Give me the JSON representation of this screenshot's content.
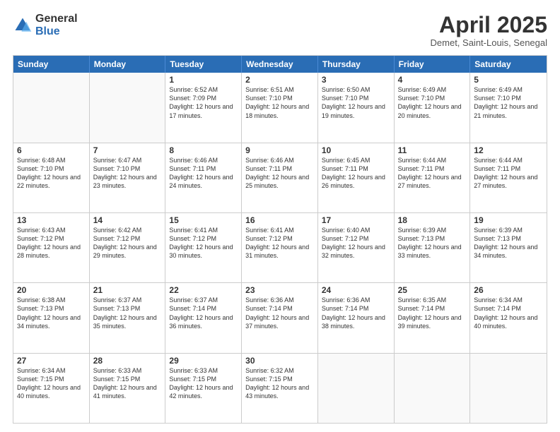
{
  "logo": {
    "general": "General",
    "blue": "Blue"
  },
  "title": "April 2025",
  "subtitle": "Demet, Saint-Louis, Senegal",
  "days": [
    "Sunday",
    "Monday",
    "Tuesday",
    "Wednesday",
    "Thursday",
    "Friday",
    "Saturday"
  ],
  "rows": [
    [
      {
        "day": "",
        "info": ""
      },
      {
        "day": "",
        "info": ""
      },
      {
        "day": "1",
        "info": "Sunrise: 6:52 AM\nSunset: 7:09 PM\nDaylight: 12 hours and 17 minutes."
      },
      {
        "day": "2",
        "info": "Sunrise: 6:51 AM\nSunset: 7:10 PM\nDaylight: 12 hours and 18 minutes."
      },
      {
        "day": "3",
        "info": "Sunrise: 6:50 AM\nSunset: 7:10 PM\nDaylight: 12 hours and 19 minutes."
      },
      {
        "day": "4",
        "info": "Sunrise: 6:49 AM\nSunset: 7:10 PM\nDaylight: 12 hours and 20 minutes."
      },
      {
        "day": "5",
        "info": "Sunrise: 6:49 AM\nSunset: 7:10 PM\nDaylight: 12 hours and 21 minutes."
      }
    ],
    [
      {
        "day": "6",
        "info": "Sunrise: 6:48 AM\nSunset: 7:10 PM\nDaylight: 12 hours and 22 minutes."
      },
      {
        "day": "7",
        "info": "Sunrise: 6:47 AM\nSunset: 7:10 PM\nDaylight: 12 hours and 23 minutes."
      },
      {
        "day": "8",
        "info": "Sunrise: 6:46 AM\nSunset: 7:11 PM\nDaylight: 12 hours and 24 minutes."
      },
      {
        "day": "9",
        "info": "Sunrise: 6:46 AM\nSunset: 7:11 PM\nDaylight: 12 hours and 25 minutes."
      },
      {
        "day": "10",
        "info": "Sunrise: 6:45 AM\nSunset: 7:11 PM\nDaylight: 12 hours and 26 minutes."
      },
      {
        "day": "11",
        "info": "Sunrise: 6:44 AM\nSunset: 7:11 PM\nDaylight: 12 hours and 27 minutes."
      },
      {
        "day": "12",
        "info": "Sunrise: 6:44 AM\nSunset: 7:11 PM\nDaylight: 12 hours and 27 minutes."
      }
    ],
    [
      {
        "day": "13",
        "info": "Sunrise: 6:43 AM\nSunset: 7:12 PM\nDaylight: 12 hours and 28 minutes."
      },
      {
        "day": "14",
        "info": "Sunrise: 6:42 AM\nSunset: 7:12 PM\nDaylight: 12 hours and 29 minutes."
      },
      {
        "day": "15",
        "info": "Sunrise: 6:41 AM\nSunset: 7:12 PM\nDaylight: 12 hours and 30 minutes."
      },
      {
        "day": "16",
        "info": "Sunrise: 6:41 AM\nSunset: 7:12 PM\nDaylight: 12 hours and 31 minutes."
      },
      {
        "day": "17",
        "info": "Sunrise: 6:40 AM\nSunset: 7:12 PM\nDaylight: 12 hours and 32 minutes."
      },
      {
        "day": "18",
        "info": "Sunrise: 6:39 AM\nSunset: 7:13 PM\nDaylight: 12 hours and 33 minutes."
      },
      {
        "day": "19",
        "info": "Sunrise: 6:39 AM\nSunset: 7:13 PM\nDaylight: 12 hours and 34 minutes."
      }
    ],
    [
      {
        "day": "20",
        "info": "Sunrise: 6:38 AM\nSunset: 7:13 PM\nDaylight: 12 hours and 34 minutes."
      },
      {
        "day": "21",
        "info": "Sunrise: 6:37 AM\nSunset: 7:13 PM\nDaylight: 12 hours and 35 minutes."
      },
      {
        "day": "22",
        "info": "Sunrise: 6:37 AM\nSunset: 7:14 PM\nDaylight: 12 hours and 36 minutes."
      },
      {
        "day": "23",
        "info": "Sunrise: 6:36 AM\nSunset: 7:14 PM\nDaylight: 12 hours and 37 minutes."
      },
      {
        "day": "24",
        "info": "Sunrise: 6:36 AM\nSunset: 7:14 PM\nDaylight: 12 hours and 38 minutes."
      },
      {
        "day": "25",
        "info": "Sunrise: 6:35 AM\nSunset: 7:14 PM\nDaylight: 12 hours and 39 minutes."
      },
      {
        "day": "26",
        "info": "Sunrise: 6:34 AM\nSunset: 7:14 PM\nDaylight: 12 hours and 40 minutes."
      }
    ],
    [
      {
        "day": "27",
        "info": "Sunrise: 6:34 AM\nSunset: 7:15 PM\nDaylight: 12 hours and 40 minutes."
      },
      {
        "day": "28",
        "info": "Sunrise: 6:33 AM\nSunset: 7:15 PM\nDaylight: 12 hours and 41 minutes."
      },
      {
        "day": "29",
        "info": "Sunrise: 6:33 AM\nSunset: 7:15 PM\nDaylight: 12 hours and 42 minutes."
      },
      {
        "day": "30",
        "info": "Sunrise: 6:32 AM\nSunset: 7:15 PM\nDaylight: 12 hours and 43 minutes."
      },
      {
        "day": "",
        "info": ""
      },
      {
        "day": "",
        "info": ""
      },
      {
        "day": "",
        "info": ""
      }
    ]
  ]
}
